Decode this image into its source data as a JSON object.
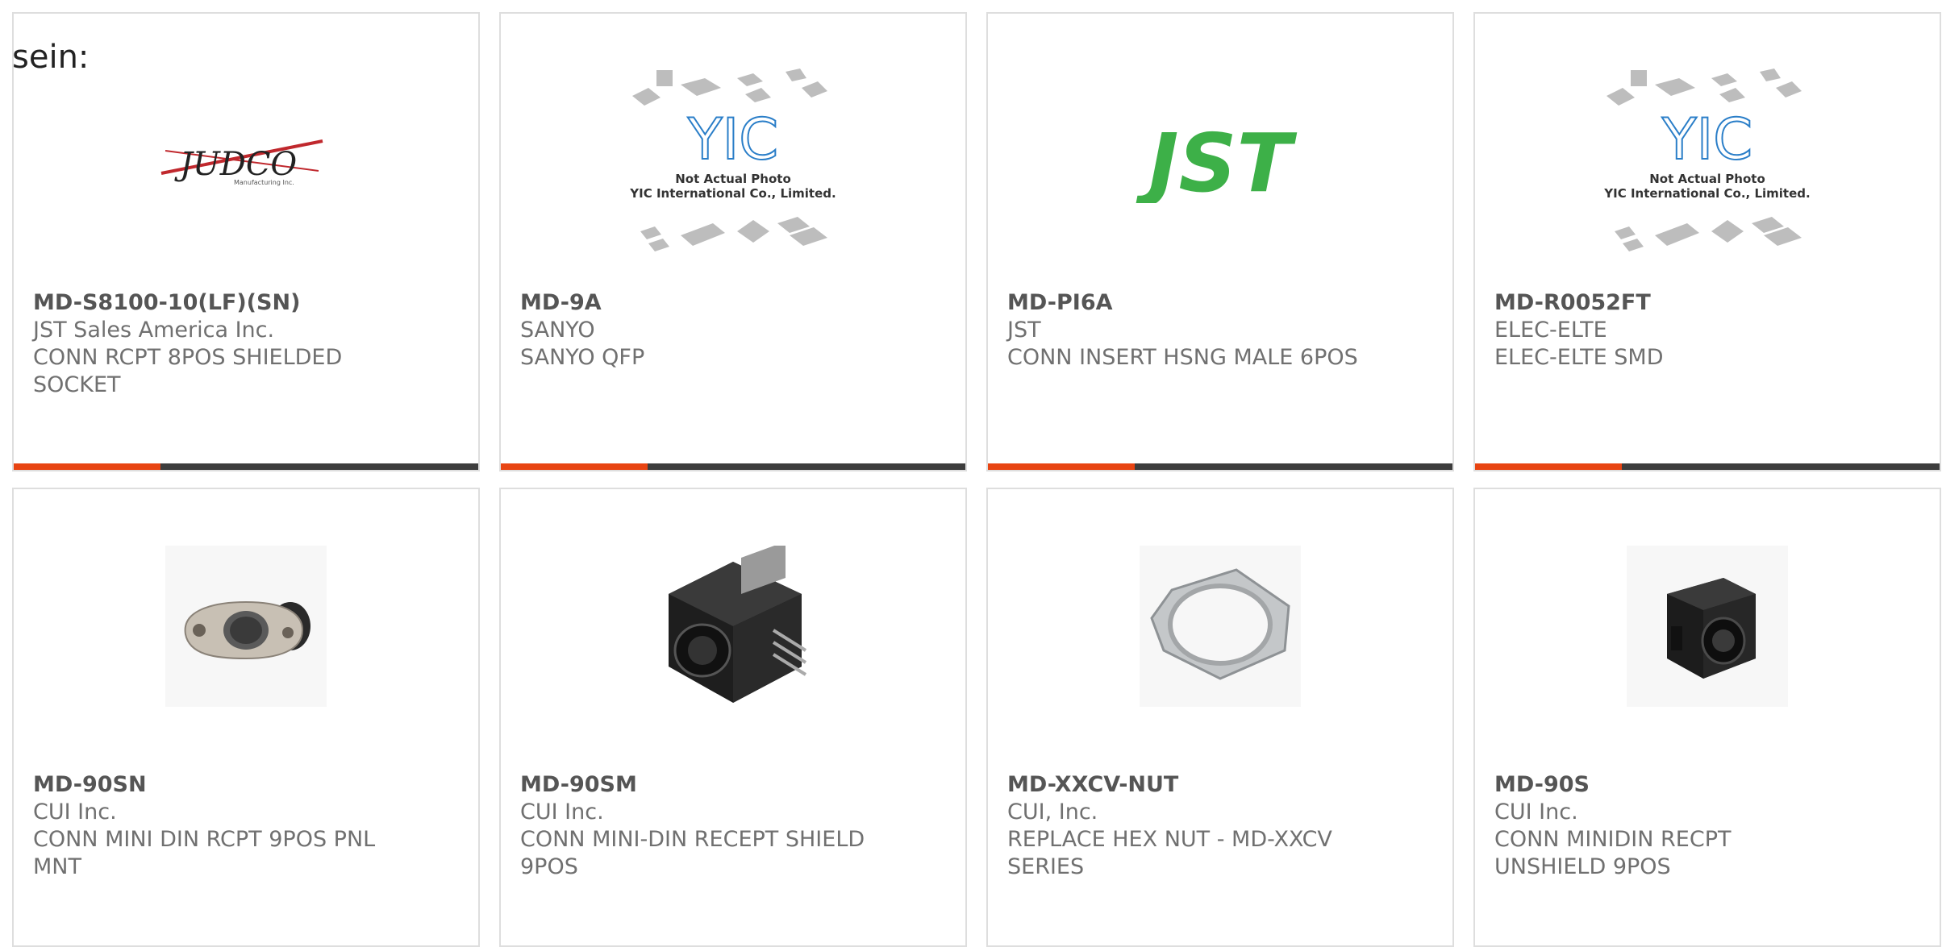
{
  "header_label": "sein:",
  "accent_color": "#e84412",
  "bar_color": "#3d3d3d",
  "products": [
    {
      "part": "MD-S8100-10(LF)(SN)",
      "manufacturer": "JST Sales America Inc.",
      "description": "CONN RCPT 8POS SHIELDED SOCKET",
      "image": "judco-logo",
      "logo_text": "JUDCO",
      "logo_sub": "Manufacturing Inc."
    },
    {
      "part": "MD-9A",
      "manufacturer": "SANYO",
      "description": "SANYO QFP",
      "image": "yic-placeholder",
      "logo_text": "YIC",
      "logo_sub": "Not Actual Photo",
      "logo_sub2": "YIC International Co., Limited."
    },
    {
      "part": "MD-PI6A",
      "manufacturer": "JST",
      "description": "CONN INSERT HSNG MALE 6POS",
      "image": "jst-logo",
      "logo_text": "JST"
    },
    {
      "part": "MD-R0052FT",
      "manufacturer": "ELEC-ELTE",
      "description": "ELEC-ELTE SMD",
      "image": "yic-placeholder",
      "logo_text": "YIC",
      "logo_sub": "Not Actual Photo",
      "logo_sub2": "YIC International Co., Limited."
    },
    {
      "part": "MD-90SN",
      "manufacturer": "CUI Inc.",
      "description": "CONN MINI DIN RCPT 9POS PNL MNT",
      "image": "panel-mount-din-connector"
    },
    {
      "part": "MD-90SM",
      "manufacturer": "CUI Inc.",
      "description": "CONN MINI-DIN RECEPT SHIELD 9POS",
      "image": "shielded-din-connector"
    },
    {
      "part": "MD-XXCV-NUT",
      "manufacturer": "CUI, Inc.",
      "description": "REPLACE HEX NUT - MD-XXCV SERIES",
      "image": "hex-nut"
    },
    {
      "part": "MD-90S",
      "manufacturer": "CUI Inc.",
      "description": "CONN MINIDIN RECPT UNSHIELD 9POS",
      "image": "unshielded-din-connector"
    }
  ]
}
